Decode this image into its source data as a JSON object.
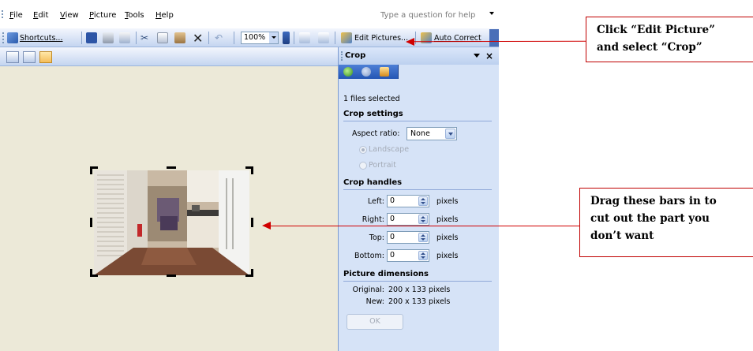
{
  "menubar": {
    "items": [
      {
        "label": "File"
      },
      {
        "label": "Edit"
      },
      {
        "label": "View"
      },
      {
        "label": "Picture"
      },
      {
        "label": "Tools"
      },
      {
        "label": "Help"
      }
    ],
    "help_placeholder": "Type a question for help"
  },
  "toolbar": {
    "shortcuts_label": "Shortcuts...",
    "zoom_value": "100%",
    "edit_pictures_label": "Edit Pictures...",
    "auto_correct_label": "Auto Correct"
  },
  "taskpane": {
    "title": "Crop",
    "files_selected": "1 files selected",
    "crop_settings": {
      "heading": "Crop settings",
      "aspect_label": "Aspect ratio:",
      "aspect_value": "None",
      "landscape_label": "Landscape",
      "portrait_label": "Portrait"
    },
    "crop_handles": {
      "heading": "Crop handles",
      "rows": [
        {
          "label": "Left:",
          "value": "0",
          "unit": "pixels"
        },
        {
          "label": "Right:",
          "value": "0",
          "unit": "pixels"
        },
        {
          "label": "Top:",
          "value": "0",
          "unit": "pixels"
        },
        {
          "label": "Bottom:",
          "value": "0",
          "unit": "pixels"
        }
      ]
    },
    "dimensions": {
      "heading": "Picture dimensions",
      "original_label": "Original:",
      "original_value": "200 x 133 pixels",
      "new_label": "New:",
      "new_value": "200 x 133 pixels"
    },
    "ok_label": "OK"
  },
  "annotations": {
    "callout_1": [
      "Click “Edit Picture”",
      "and select “Crop”"
    ],
    "callout_2": [
      "Drag these bars in to",
      "cut out the part you",
      "don’t want"
    ]
  },
  "colors": {
    "accent_red": "#d00000",
    "toolbar_blue": "#c4d5f0",
    "pane_blue": "#d6e3f7",
    "canvas_beige": "#ece9d8"
  }
}
